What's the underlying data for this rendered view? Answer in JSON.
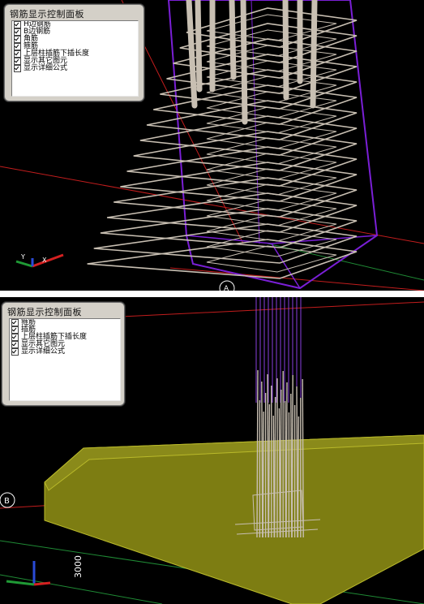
{
  "top_view": {
    "panel": {
      "title": "钢筋显示控制面板",
      "items": [
        {
          "label": "H边钢筋",
          "checked": true
        },
        {
          "label": "B边钢筋",
          "checked": true
        },
        {
          "label": "角筋",
          "checked": true
        },
        {
          "label": "箍筋",
          "checked": true
        },
        {
          "label": "上层柱插筋下插长度",
          "checked": true
        },
        {
          "label": "显示其它图元",
          "checked": true
        },
        {
          "label": "显示详细公式",
          "checked": true
        }
      ]
    },
    "axis_marker": "A",
    "triad": {
      "x": "X",
      "y": "Y"
    }
  },
  "bottom_view": {
    "panel": {
      "title": "钢筋显示控制面板",
      "items": [
        {
          "label": "箍筋",
          "checked": true
        },
        {
          "label": "插筋",
          "checked": true
        },
        {
          "label": "上层柱插筋下插长度",
          "checked": true
        },
        {
          "label": "显示其它图元",
          "checked": true
        },
        {
          "label": "显示详细公式",
          "checked": true
        }
      ]
    },
    "axis_marker": "B",
    "dimension_text": "3000"
  },
  "colors": {
    "viewport_bg": "#000000",
    "column_outline": "#7a1fd6",
    "rebar": "#c8bfb2",
    "grid_red": "#c21d1d",
    "grid_green": "#1f8a35",
    "foundation": "#7d7d12",
    "foundation_edge": "#b9b92a",
    "panel_bg": "#d4d0c8"
  }
}
